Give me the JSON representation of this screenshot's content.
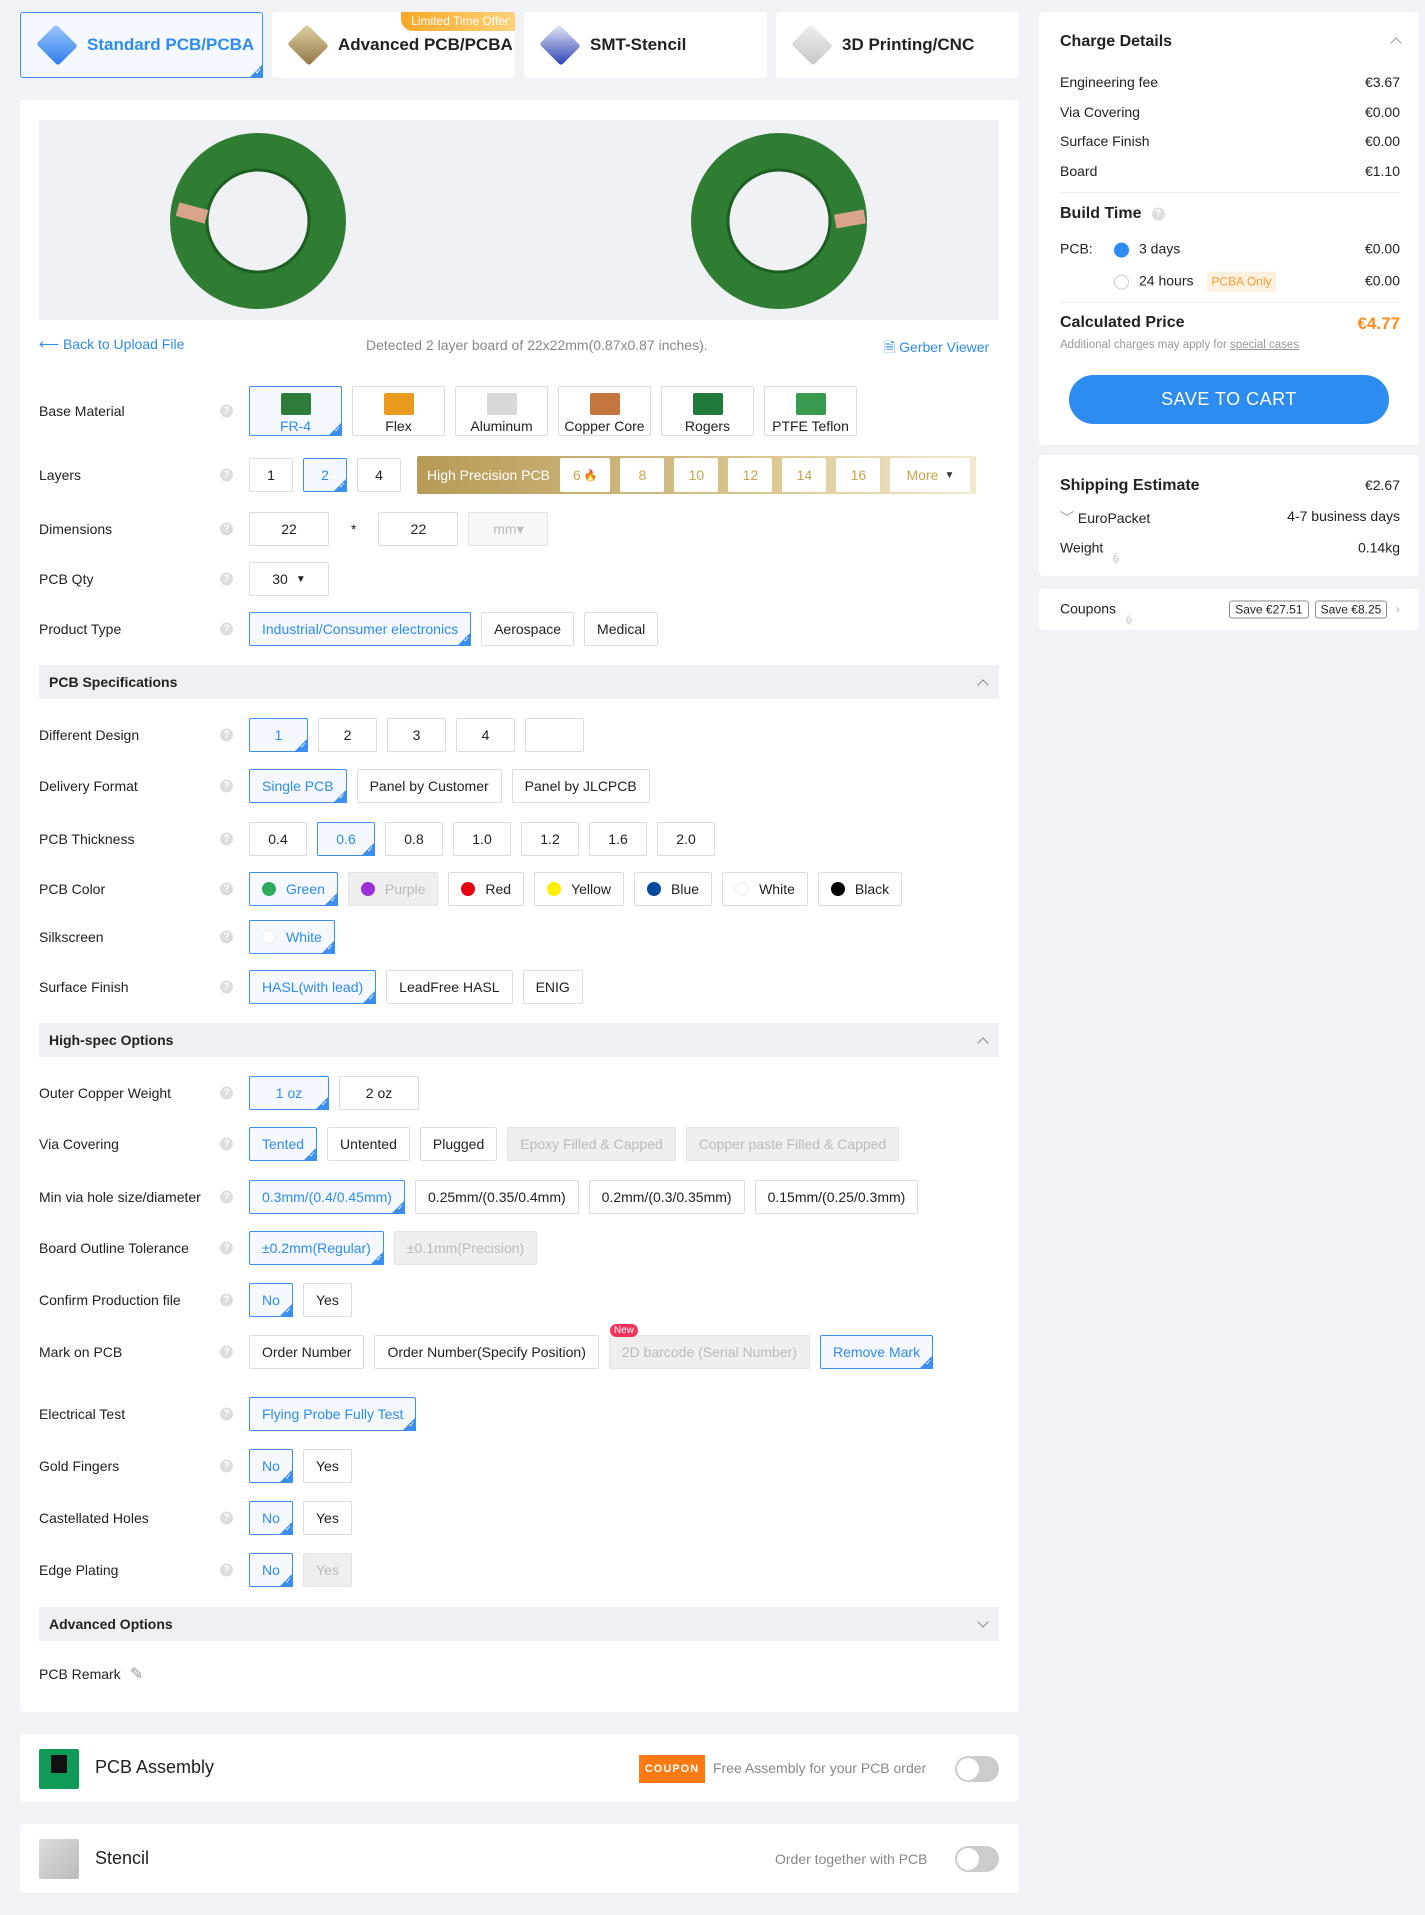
{
  "tabs": [
    {
      "label": "Standard PCB/PCBA",
      "selected": true,
      "icon": "standard-pcb-icon"
    },
    {
      "label": "Advanced PCB/PCBA",
      "badge": "Limited Time Offer",
      "icon": "advanced-pcb-icon"
    },
    {
      "label": "SMT-Stencil",
      "icon": "smt-stencil-icon"
    },
    {
      "label": "3D Printing/CNC",
      "icon": "3d-printing-icon"
    }
  ],
  "preview": {
    "back_label": "Back to Upload File",
    "detected": "Detected 2 layer board of 22x22mm(0.87x0.87 inches).",
    "gerber_label": "Gerber Viewer",
    "board_color": "#2e7d32"
  },
  "form": [
    {
      "type": "material",
      "label": "Base Material",
      "options": [
        {
          "label": "FR-4",
          "state": "sel",
          "color": "#2f7d3a"
        },
        {
          "label": "Flex",
          "color": "#e89a1c"
        },
        {
          "label": "Aluminum",
          "color": "#d8d8d8"
        },
        {
          "label": "Copper Core",
          "color": "#c5763f"
        },
        {
          "label": "Rogers",
          "color": "#1f7a3c"
        },
        {
          "label": "PTFE Teflon",
          "color": "#3a9a52"
        }
      ]
    },
    {
      "type": "layers",
      "label": "Layers",
      "options": [
        {
          "label": "1"
        },
        {
          "label": "2",
          "state": "sel"
        },
        {
          "label": "4"
        }
      ],
      "high_precision": {
        "label": "High Precision PCB",
        "options": [
          "6",
          "8",
          "10",
          "12",
          "14",
          "16"
        ],
        "more": "More"
      }
    },
    {
      "type": "dims",
      "label": "Dimensions",
      "width": "22",
      "separator": "*",
      "height": "22",
      "unit": "mm"
    },
    {
      "type": "select",
      "label": "PCB Qty",
      "value": "30"
    },
    {
      "label": "Product Type",
      "options": [
        {
          "label": "Industrial/Consumer electronics",
          "state": "sel"
        },
        {
          "label": "Aerospace"
        },
        {
          "label": "Medical"
        }
      ]
    },
    {
      "type": "section",
      "label": "PCB Specifications",
      "expanded": true
    },
    {
      "label": "Different Design",
      "min": 59,
      "options": [
        {
          "label": "1",
          "state": "sel"
        },
        {
          "label": "2"
        },
        {
          "label": "3"
        },
        {
          "label": "4"
        },
        {
          "label": ""
        }
      ]
    },
    {
      "label": "Delivery Format",
      "options": [
        {
          "label": "Single PCB",
          "state": "sel"
        },
        {
          "label": "Panel by Customer"
        },
        {
          "label": "Panel by JLCPCB"
        }
      ]
    },
    {
      "label": "PCB Thickness",
      "min": 58,
      "options": [
        {
          "label": "0.4"
        },
        {
          "label": "0.6",
          "state": "sel"
        },
        {
          "label": "0.8"
        },
        {
          "label": "1.0"
        },
        {
          "label": "1.2"
        },
        {
          "label": "1.6"
        },
        {
          "label": "2.0"
        }
      ]
    },
    {
      "label": "PCB Color",
      "options": [
        {
          "label": "Green",
          "state": "sel",
          "swatch": "#2eaa5c"
        },
        {
          "label": "Purple",
          "state": "dis",
          "swatch": "#9b30d9"
        },
        {
          "label": "Red",
          "swatch": "#e60012"
        },
        {
          "label": "Yellow",
          "swatch": "#ffee00"
        },
        {
          "label": "Blue",
          "swatch": "#0a49a0"
        },
        {
          "label": "White",
          "swatch": "#ffffff"
        },
        {
          "label": "Black",
          "swatch": "#000000"
        }
      ]
    },
    {
      "label": "Silkscreen",
      "options": [
        {
          "label": "White",
          "state": "sel",
          "swatch": "#ffffff"
        }
      ]
    },
    {
      "label": "Surface Finish",
      "options": [
        {
          "label": "HASL(with lead)",
          "state": "sel"
        },
        {
          "label": "LeadFree HASL"
        },
        {
          "label": "ENIG"
        }
      ]
    },
    {
      "type": "section",
      "label": "High-spec Options",
      "expanded": true
    },
    {
      "label": "Outer Copper Weight",
      "min": 80,
      "options": [
        {
          "label": "1 oz",
          "state": "sel"
        },
        {
          "label": "2 oz"
        }
      ]
    },
    {
      "label": "Via Covering",
      "options": [
        {
          "label": "Tented",
          "state": "sel"
        },
        {
          "label": "Untented"
        },
        {
          "label": "Plugged"
        },
        {
          "label": "Epoxy Filled & Capped",
          "state": "dis"
        },
        {
          "label": "Copper paste Filled & Capped",
          "state": "dis"
        }
      ]
    },
    {
      "label": "Min via hole size/diameter",
      "options": [
        {
          "label": "0.3mm/(0.4/0.45mm)",
          "state": "sel"
        },
        {
          "label": "0.25mm/(0.35/0.4mm)"
        },
        {
          "label": "0.2mm/(0.3/0.35mm)"
        },
        {
          "label": "0.15mm/(0.25/0.3mm)"
        }
      ]
    },
    {
      "label": "Board Outline Tolerance",
      "options": [
        {
          "label": "±0.2mm(Regular)",
          "state": "sel"
        },
        {
          "label": "±0.1mm(Precision)",
          "state": "dis"
        }
      ]
    },
    {
      "label": "Confirm Production file",
      "options": [
        {
          "label": "No",
          "state": "sel"
        },
        {
          "label": "Yes"
        }
      ]
    },
    {
      "label": "Mark on PCB",
      "options": [
        {
          "label": "Order Number"
        },
        {
          "label": "Order Number(Specify Position)"
        },
        {
          "label": "2D barcode (Serial Number)",
          "state": "dis",
          "tag": "New"
        },
        {
          "label": "Remove Mark",
          "state": "sel"
        }
      ]
    },
    {
      "label": "Electrical Test",
      "options": [
        {
          "label": "Flying Probe Fully Test",
          "state": "sel"
        }
      ]
    },
    {
      "label": "Gold Fingers",
      "options": [
        {
          "label": "No",
          "state": "sel"
        },
        {
          "label": "Yes"
        }
      ]
    },
    {
      "label": "Castellated Holes",
      "options": [
        {
          "label": "No",
          "state": "sel"
        },
        {
          "label": "Yes"
        }
      ]
    },
    {
      "label": "Edge Plating",
      "options": [
        {
          "label": "No",
          "state": "sel"
        },
        {
          "label": "Yes",
          "state": "dis"
        }
      ]
    },
    {
      "type": "section",
      "label": "Advanced Options",
      "expanded": false
    },
    {
      "type": "remark",
      "label": "PCB Remark"
    }
  ],
  "assembly": {
    "title": "PCB Assembly",
    "coupon": "COUPON",
    "note": "Free Assembly for your PCB order",
    "enabled": false
  },
  "stencil": {
    "title": "Stencil",
    "note": "Order together with PCB",
    "enabled": false
  },
  "charges": {
    "title": "Charge Details",
    "items": [
      {
        "label": "Engineering fee",
        "value": "€3.67"
      },
      {
        "label": "Via Covering",
        "value": "€0.00"
      },
      {
        "label": "Surface Finish",
        "value": "€0.00"
      },
      {
        "label": "Board",
        "value": "€1.10"
      }
    ],
    "build_time": {
      "title": "Build Time",
      "pcb_label": "PCB:",
      "options": [
        {
          "label": "3 days",
          "value": "€0.00",
          "selected": true
        },
        {
          "label": "24 hours",
          "value": "€0.00",
          "tag": "PCBA Only"
        }
      ]
    },
    "calculated": {
      "title": "Calculated Price",
      "value": "€4.77",
      "note": "Additional charges may apply for",
      "note_link": "special cases"
    },
    "save_button": "SAVE TO CART"
  },
  "shipping": {
    "title": "Shipping Estimate",
    "value": "€2.67",
    "method": "EuroPacket",
    "time": "4-7 business days",
    "weight_label": "Weight",
    "weight": "0.14kg"
  },
  "coupons": {
    "label": "Coupons",
    "tags": [
      "Save €27.51",
      "Save €8.25"
    ]
  },
  "colors": {
    "accent": "#2d8cf0",
    "price": "#ff8a1f",
    "save_button": "#2d8cf0"
  }
}
